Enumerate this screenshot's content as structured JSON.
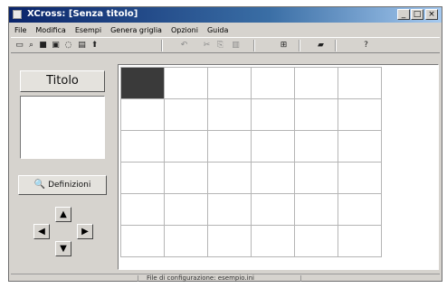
{
  "window": {
    "title": "XCross: [Senza titolo]"
  },
  "title_buttons": {
    "minimize": "_",
    "maximize": "□",
    "close": "×"
  },
  "menu": [
    "File",
    "Modifica",
    "Esempi",
    "Genera griglia",
    "Opzioni",
    "Guida"
  ],
  "toolbar": [
    {
      "name": "new-icon",
      "glyph": "▭"
    },
    {
      "name": "open-icon",
      "glyph": "⌕"
    },
    {
      "name": "save-icon",
      "glyph": "■"
    },
    {
      "name": "save-as-icon",
      "glyph": "▣"
    },
    {
      "name": "view-icon",
      "glyph": "◌"
    },
    {
      "name": "print-icon",
      "glyph": "▤"
    },
    {
      "name": "arrow-icon",
      "glyph": "⬆"
    },
    {
      "name": "undo-icon",
      "glyph": "↶"
    },
    {
      "name": "cut-icon",
      "glyph": "✂"
    },
    {
      "name": "copy-icon",
      "glyph": "⎘"
    },
    {
      "name": "paste-icon",
      "glyph": "▥"
    },
    {
      "name": "grid-icon",
      "glyph": "⊞"
    },
    {
      "name": "comment-icon",
      "glyph": "▰"
    },
    {
      "name": "help-icon",
      "glyph": "?"
    }
  ],
  "left_panel": {
    "title_button": "Titolo",
    "definition_button": "Definizioni",
    "arrows": {
      "up": "▲",
      "left": "◀",
      "right": "▶",
      "down": "▼"
    }
  },
  "grid": {
    "rows": 6,
    "cols": 6,
    "selected": [
      0,
      0
    ]
  },
  "statusbar": {
    "text": "File di configurazione: esempio.ini"
  }
}
